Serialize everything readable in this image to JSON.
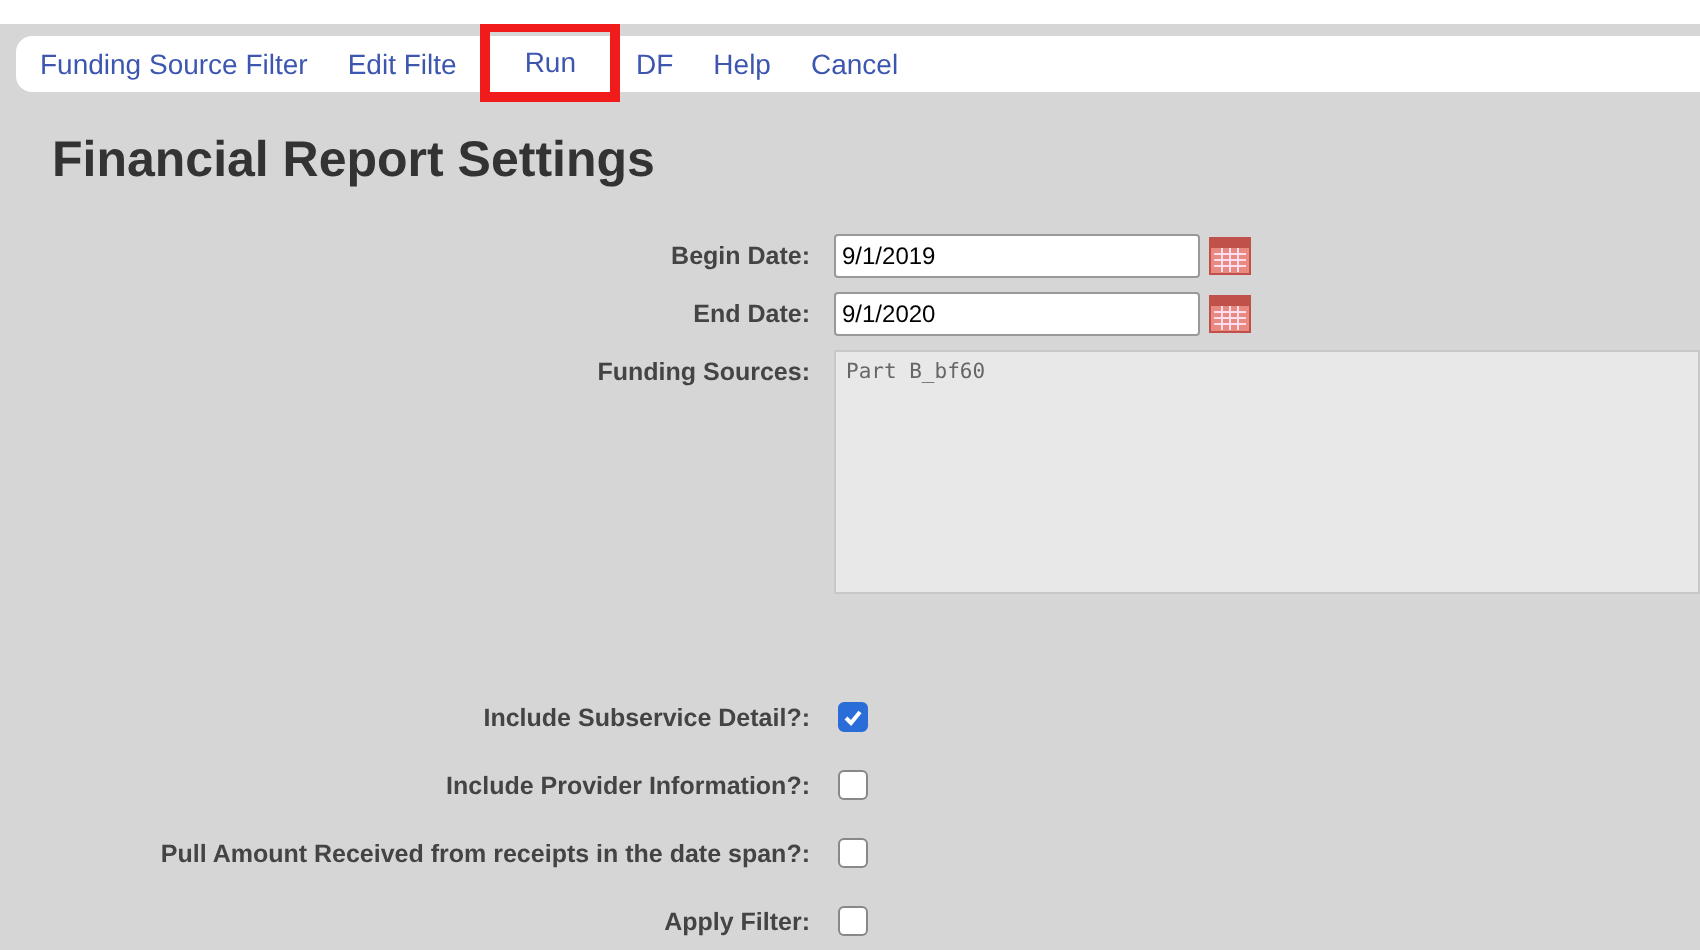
{
  "menu": [
    {
      "label": "Funding Source Filter",
      "highlighted": false
    },
    {
      "label": "Edit Filte",
      "highlighted": false
    },
    {
      "label": "Run",
      "highlighted": true
    },
    {
      "label": "DF",
      "highlighted": false
    },
    {
      "label": "Help",
      "highlighted": false
    },
    {
      "label": "Cancel",
      "highlighted": false
    }
  ],
  "title": "Financial Report Settings",
  "dates": [
    {
      "label": "Begin Date:",
      "value": "9/1/2019"
    },
    {
      "label": "End Date:",
      "value": "9/1/2020"
    }
  ],
  "funding_sources": {
    "label": "Funding Sources:",
    "value": "Part B_bf60"
  },
  "options": [
    {
      "label": "Include Subservice Detail?:",
      "checked": true
    },
    {
      "label": "Include Provider Information?:",
      "checked": false
    },
    {
      "label": "Pull Amount Received from receipts in the date span?:",
      "checked": false
    },
    {
      "label": "Apply Filter:",
      "checked": false
    }
  ]
}
